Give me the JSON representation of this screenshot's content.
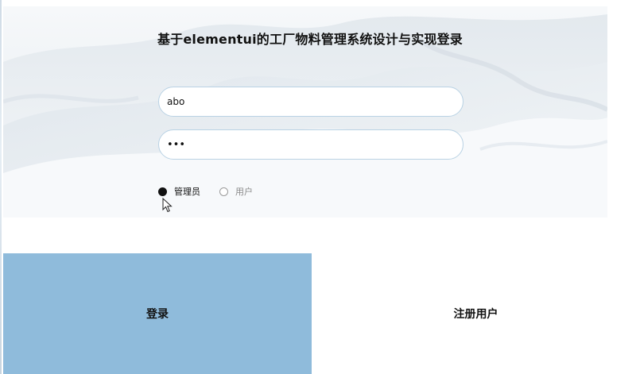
{
  "login": {
    "title": "基于elementui的工厂物料管理系统设计与实现登录",
    "username_value": "abo",
    "password_value": "•••",
    "roles": [
      {
        "label": "管理员",
        "checked": true
      },
      {
        "label": "用户",
        "checked": false
      }
    ],
    "login_button": "登录",
    "register_button": "注册用户"
  },
  "colors": {
    "login_button_bg": "#8fbbdb",
    "input_border": "#b9d2e4"
  },
  "icons": {
    "cursor": "mouse-pointer-icon"
  }
}
